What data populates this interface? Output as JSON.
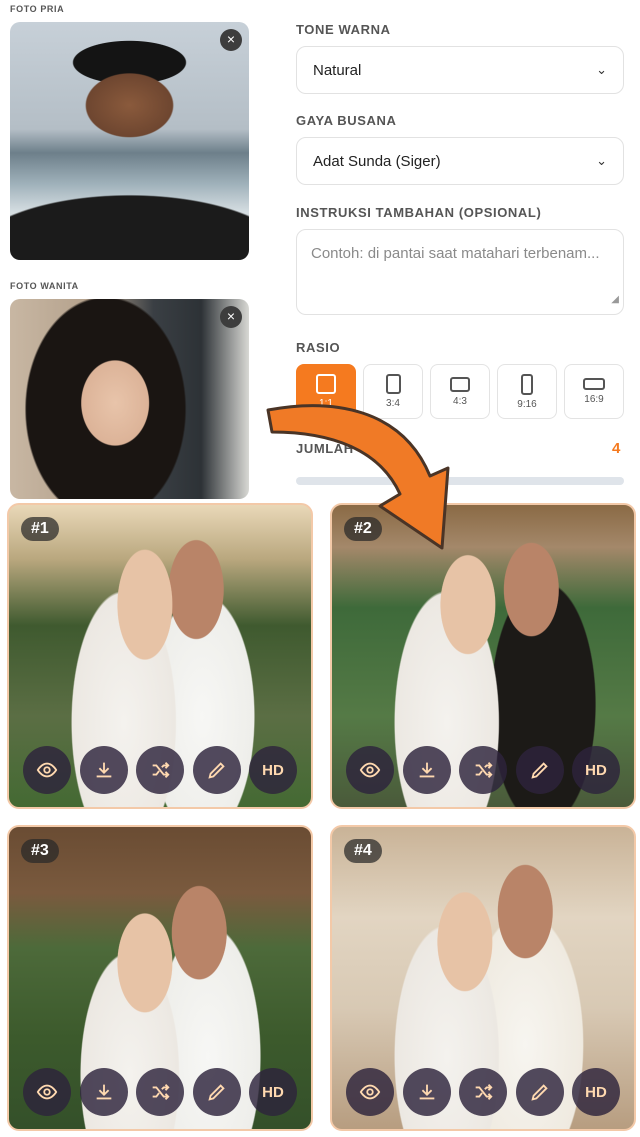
{
  "photos": {
    "pria": {
      "label": "FOTO PRIA",
      "remove": "×"
    },
    "wanita": {
      "label": "FOTO WANITA",
      "remove": "×"
    }
  },
  "form": {
    "tone": {
      "label": "TONE WARNA",
      "value": "Natural"
    },
    "busana": {
      "label": "GAYA BUSANA",
      "value": "Adat Sunda (Siger)"
    },
    "instruksi": {
      "label": "INSTRUKSI TAMBAHAN (OPSIONAL)",
      "placeholder": "Contoh: di pantai saat matahari terbenam..."
    },
    "rasio": {
      "label": "RASIO",
      "selected": "1:1",
      "options": [
        "1:1",
        "3:4",
        "4:3",
        "9:16",
        "16:9"
      ]
    },
    "jumlah": {
      "label": "JUMLAH",
      "value": "4"
    }
  },
  "results": [
    {
      "badge": "#1"
    },
    {
      "badge": "#2"
    },
    {
      "badge": "#3"
    },
    {
      "badge": "#4"
    }
  ],
  "actions": {
    "view": "eye-icon",
    "download": "download-icon",
    "shuffle": "shuffle-icon",
    "edit": "pencil-icon",
    "hd_label": "HD"
  },
  "colors": {
    "accent": "#f57a1f",
    "action_bg": "#2d233c",
    "action_fg": "#ffd9b0"
  }
}
